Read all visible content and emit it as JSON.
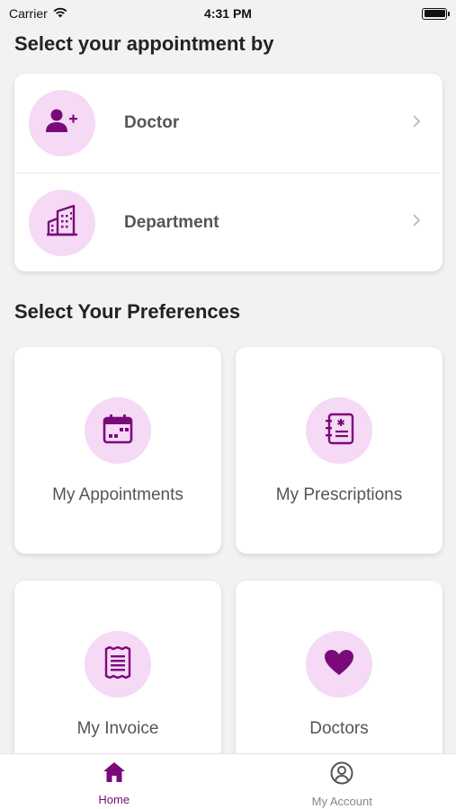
{
  "status_bar": {
    "carrier": "Carrier",
    "time": "4:31 PM"
  },
  "section_appointment": {
    "title": "Select your appointment by",
    "items": [
      {
        "label": "Doctor",
        "icon": "add-person-icon"
      },
      {
        "label": "Department",
        "icon": "building-icon"
      }
    ]
  },
  "section_preferences": {
    "title": "Select Your Preferences",
    "tiles": [
      {
        "label": "My Appointments",
        "icon": "calendar-icon"
      },
      {
        "label": "My Prescriptions",
        "icon": "prescription-icon"
      },
      {
        "label": "My Invoice",
        "icon": "invoice-icon"
      },
      {
        "label": "Doctors",
        "icon": "heart-icon"
      }
    ]
  },
  "tabbar": {
    "tabs": [
      {
        "label": "Home",
        "icon": "home-icon",
        "active": true
      },
      {
        "label": "My Account",
        "icon": "account-icon",
        "active": false
      }
    ]
  },
  "colors": {
    "accent": "#7a0a7a",
    "icon_bg": "#f5d9f5",
    "background": "#f2f2f4"
  }
}
